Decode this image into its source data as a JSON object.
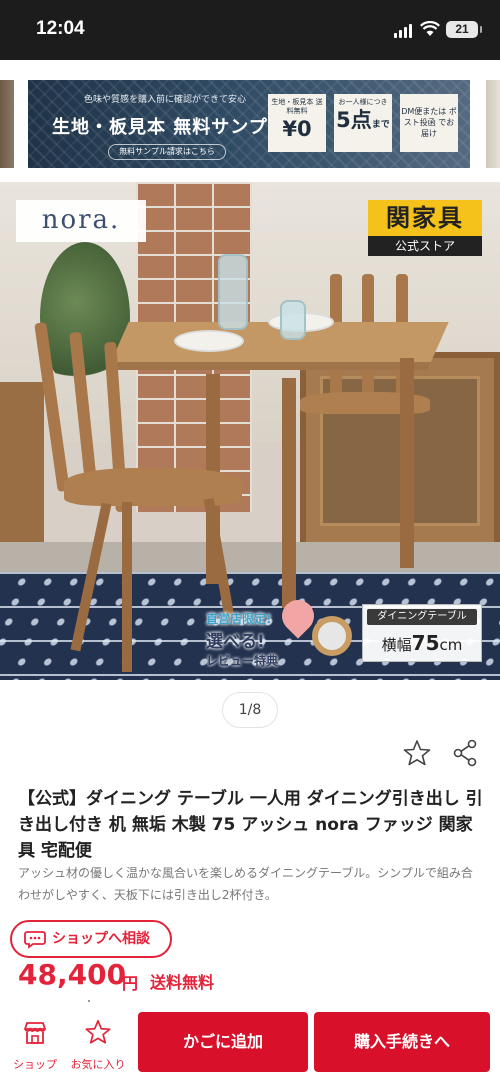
{
  "status_bar": {
    "time": "12:04",
    "battery": "21"
  },
  "top_banner": {
    "subline": "色味や質感を購入前に確認ができて安心",
    "headline": "生地・板見本 無料サンプル",
    "link_label": "無料サンプル請求はこちら",
    "box1_caption": "生地・板見本 送料無料",
    "box1_value": "¥0",
    "box2_caption": "お一人様につき",
    "box2_value": "5点",
    "box2_suffix": "まで",
    "box3_caption": "DM便または ポスト投函 でお届け"
  },
  "hero": {
    "brand_left": "nora.",
    "brand_right_main": "関家具",
    "brand_right_sub": "公式ストア",
    "promo_line1": "直営店限定!",
    "promo_line2": "選べる!",
    "promo_line3": "レビュー特典",
    "size_caption": "ダイニングテーブル",
    "size_prefix": "横幅",
    "size_number": "75",
    "size_unit": "cm"
  },
  "pager": {
    "label": "1/8"
  },
  "product": {
    "title": "【公式】ダイニング テーブル 一人用 ダイニング引き出し 引き出し付き 机 無垢 木製 75 アッシュ nora ファッジ 関家具 宅配便",
    "description": "アッシュ材の優しく温かな風合いを楽しめるダイニングテーブル。シンプルで組み合わせがしやすく、天板下には引き出し2杯付き。",
    "consult_label": "ショップへ相談",
    "price": "48,400",
    "price_unit": "円",
    "shipping_label": "送料無料"
  },
  "bottom_nav": {
    "shop_label": "ショップ",
    "favorite_label": "お気に入り",
    "cart_label": "かごに追加",
    "buy_label": "購入手続きへ"
  },
  "colors": {
    "accent": "#e2233a",
    "button": "#d8102a",
    "status_bar": "#1c1c1c"
  },
  "icons": [
    "signal-icon",
    "wifi-icon",
    "battery-icon",
    "star-icon",
    "share-icon",
    "chat-icon",
    "shop-icon",
    "favorite-star-icon"
  ]
}
